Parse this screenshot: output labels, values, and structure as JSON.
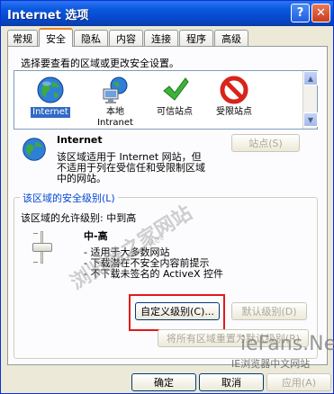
{
  "window": {
    "title": "Internet 选项",
    "help_label": "?",
    "close_label": "✕"
  },
  "tabs": [
    {
      "label": "常规"
    },
    {
      "label": "安全"
    },
    {
      "label": "隐私"
    },
    {
      "label": "内容"
    },
    {
      "label": "连接"
    },
    {
      "label": "程序"
    },
    {
      "label": "高级"
    }
  ],
  "active_tab": "安全",
  "security": {
    "zone_prompt": "选择要查看的区域或更改安全设置。",
    "zones": [
      {
        "label": "Internet",
        "icon": "globe-icon",
        "selected": true
      },
      {
        "label": "本地\nIntranet",
        "icon": "local-intranet-icon",
        "selected": false
      },
      {
        "label": "可信站点",
        "icon": "checkmark-icon",
        "selected": false
      },
      {
        "label": "受限站点",
        "icon": "restricted-icon",
        "selected": false
      }
    ],
    "zone_title": "Internet",
    "zone_description_1": "该区域适用于 Internet 网站，但",
    "zone_description_2": "不适用于列在受信任和受限制区域",
    "zone_description_3": "中的网站。",
    "sites_button": "站点(S)",
    "level_group_title": "该区域的安全级别(L)",
    "allowed_levels": "该区域的允许级别: 中到高",
    "level_name": "中-高",
    "level_points": [
      "- 适用于大多数网站",
      "- 下载潜在不安全内容前提示",
      "- 不下载未签名的 ActiveX 控件"
    ],
    "custom_level_button": "自定义级别(C)...",
    "default_level_button": "默认级别(D)",
    "reset_all_button": "将所有区域重置为默认级别(R)"
  },
  "footer": {
    "ok": "确定",
    "cancel": "取消",
    "apply": "应用(A)"
  },
  "watermarks": {
    "diagonal": "浏览器之家网站",
    "diagonal_url": "www.ieFans.Net",
    "brand": "ieFans.Net",
    "brand_sub": "IE浏览器中文网站"
  }
}
